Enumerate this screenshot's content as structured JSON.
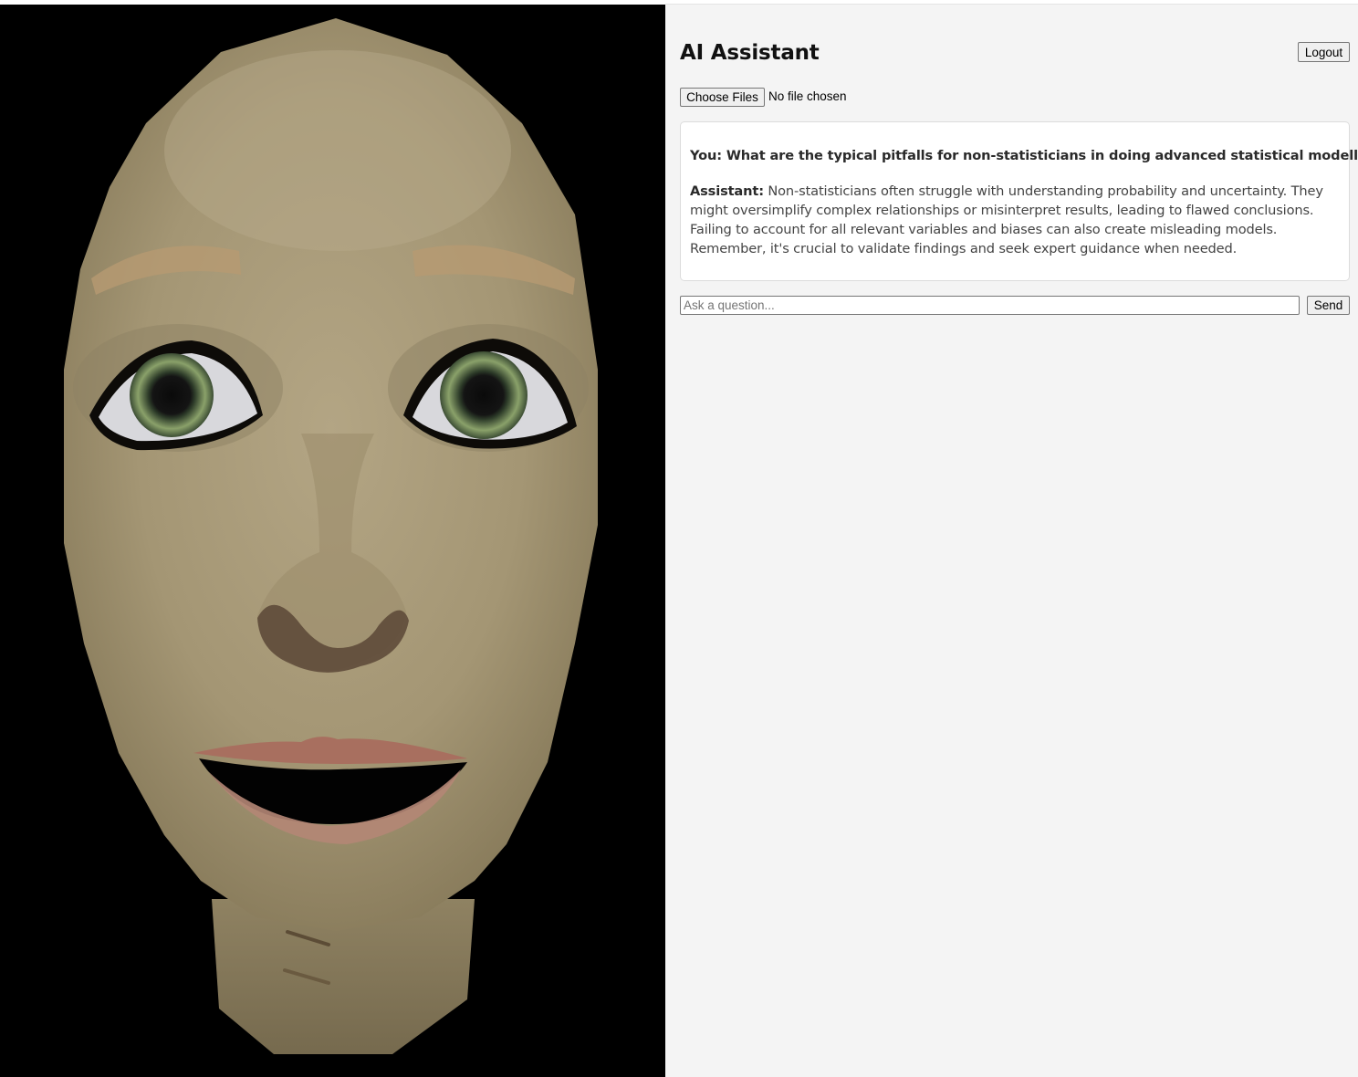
{
  "avatar": {
    "background_color": "#000000",
    "skin_color": "#a69878",
    "iris_color": "#5f7f4a"
  },
  "header": {
    "title": "AI Assistant",
    "logout_label": "Logout"
  },
  "upload": {
    "button_label": "Choose Files",
    "status_text": "No file chosen"
  },
  "conversation": {
    "messages": [
      {
        "speaker": "You:",
        "text": "What are the typical pitfalls for non-statisticians in doing advanced statistical modelling"
      },
      {
        "speaker": "Assistant:",
        "text": "Non-statisticians often struggle with understanding probability and uncertainty. They might oversimplify complex relationships or misinterpret results, leading to flawed conclusions. Failing to account for all relevant variables and biases can also create misleading models. Remember, it's crucial to validate findings and seek expert guidance when needed."
      }
    ]
  },
  "composer": {
    "placeholder": "Ask a question...",
    "send_label": "Send"
  }
}
